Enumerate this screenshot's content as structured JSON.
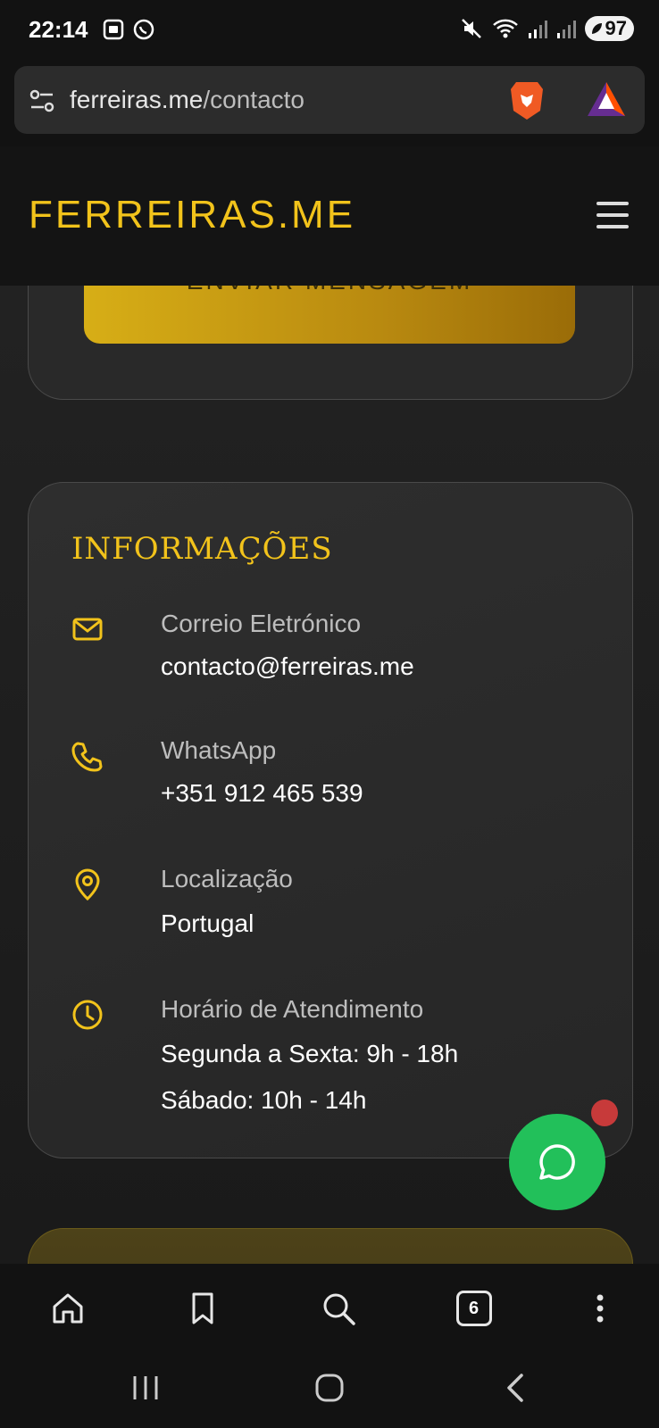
{
  "status_bar": {
    "time": "22:14",
    "battery": "97"
  },
  "browser": {
    "url_domain": "ferreiras.me",
    "url_path": "/contacto",
    "tab_count": "6"
  },
  "header": {
    "logo": "FERREIRAS.ME"
  },
  "form": {
    "submit_label": "ENVIAR MENSAGEM"
  },
  "info": {
    "title": "INFORMAÇÕES",
    "email": {
      "label": "Correio Eletrónico",
      "value": "contacto@ferreiras.me",
      "icon": "mail-icon"
    },
    "whatsapp": {
      "label": "WhatsApp",
      "value": "+351 912 465 539",
      "icon": "phone-icon"
    },
    "location": {
      "label": "Localização",
      "value": "Portugal",
      "icon": "map-pin-icon"
    },
    "hours": {
      "label": "Horário de Atendimento",
      "weekdays": "Segunda a Sexta: 9h - 18h",
      "saturday": "Sábado: 10h - 14h",
      "icon": "clock-icon"
    }
  },
  "colors": {
    "accent": "#f2c31b",
    "whatsapp": "#22c05a",
    "background": "#1c1c1c"
  }
}
